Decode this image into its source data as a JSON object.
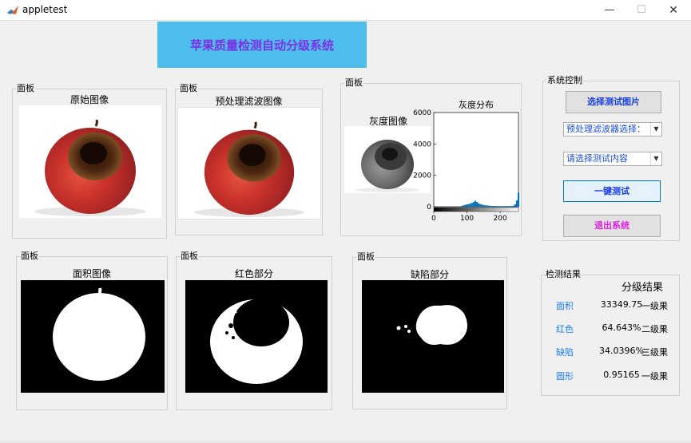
{
  "window": {
    "title": "appletest",
    "minimize": "—",
    "maximize": "☐",
    "close": "✕"
  },
  "header": {
    "title": "苹果质量检测自动分级系统"
  },
  "panels": {
    "original": {
      "group": "面板",
      "title": "原始图像"
    },
    "filtered": {
      "group": "面板",
      "title": "预处理滤波图像"
    },
    "gray": {
      "group": "面板",
      "image_title": "灰度图像",
      "hist_title": "灰度分布"
    },
    "area": {
      "group": "面板",
      "title": "面积图像"
    },
    "red": {
      "group": "面板",
      "title": "红色部分"
    },
    "defect": {
      "group": "面板",
      "title": "缺陷部分"
    }
  },
  "chart_data": {
    "type": "bar",
    "title": "灰度分布",
    "xlabel": "",
    "ylabel": "",
    "xlim": [
      0,
      255
    ],
    "ylim": [
      0,
      6000
    ],
    "xticks": [
      "0",
      "100",
      "200"
    ],
    "yticks": [
      "0",
      "2000",
      "4000",
      "6000"
    ],
    "x": [
      0,
      5,
      10,
      15,
      20,
      25,
      30,
      35,
      40,
      45,
      50,
      55,
      60,
      65,
      70,
      75,
      80,
      85,
      90,
      95,
      100,
      105,
      110,
      115,
      120,
      125,
      130,
      135,
      140,
      145,
      150,
      155,
      160,
      165,
      170,
      175,
      180,
      185,
      190,
      195,
      200,
      205,
      210,
      215,
      220,
      225,
      230,
      235,
      240,
      245,
      250,
      255
    ],
    "values": [
      0,
      0,
      0,
      0,
      0,
      0,
      0,
      0,
      0,
      0,
      0,
      0,
      0,
      0,
      0,
      0,
      20,
      60,
      90,
      120,
      150,
      170,
      200,
      250,
      300,
      380,
      300,
      220,
      180,
      140,
      110,
      90,
      80,
      70,
      60,
      55,
      50,
      45,
      40,
      40,
      40,
      40,
      40,
      40,
      40,
      40,
      40,
      50,
      70,
      150,
      400,
      900
    ],
    "color": "#0072bd"
  },
  "controls": {
    "group": "系统控制",
    "select_image": "选择测试图片",
    "filter_select": "预处理滤波器选择：",
    "content_select": "请选择测试内容",
    "run": "一键测试",
    "exit": "退出系统",
    "exit_color": "#e020e0"
  },
  "results": {
    "group": "检测结果",
    "title": "分级结果",
    "rows": [
      {
        "label": "面积",
        "value": "33349.75",
        "grade": "一级果"
      },
      {
        "label": "红色",
        "value": "64.643%",
        "grade": "二级果"
      },
      {
        "label": "缺陷",
        "value": "34.0396%",
        "grade": "三级果"
      },
      {
        "label": "圆形",
        "value": "0.95165",
        "grade": "一级果"
      }
    ]
  }
}
